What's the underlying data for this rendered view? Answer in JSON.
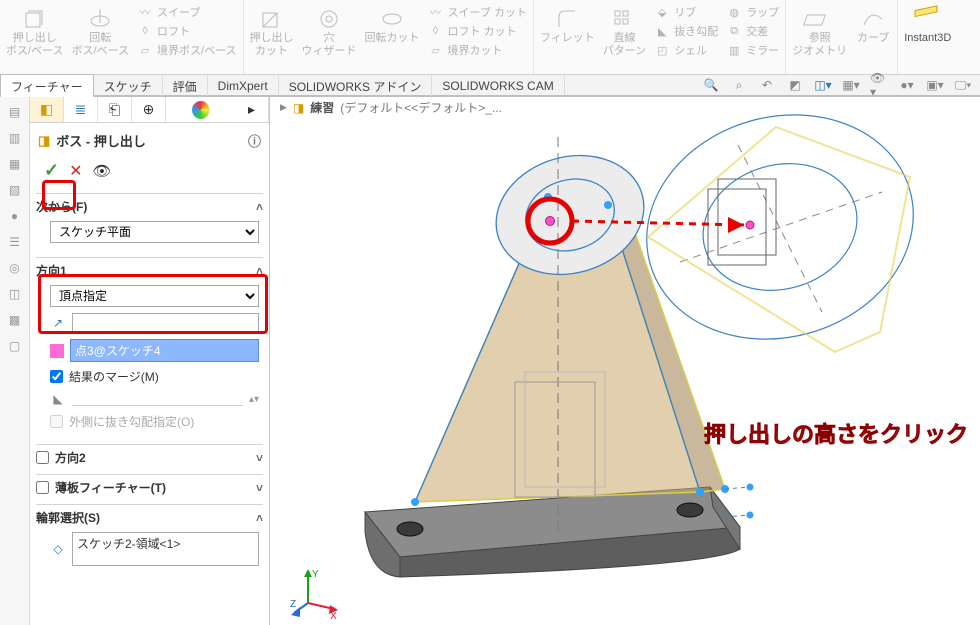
{
  "ribbon": {
    "g1": {
      "extrude": "押し出し\nボス/ベース",
      "revolve": "回転\nボス/ベース",
      "sweep": "スイープ",
      "loft": "ロフト",
      "boundary": "境界ボス/ベース"
    },
    "g2": {
      "cut": "押し出し\nカット",
      "wizard": "穴\nウィザード",
      "revcut": "回転カット",
      "sweepcut": "スイープ カット",
      "loftcut": "ロフト カット",
      "boundarycut": "境界カット"
    },
    "g3": {
      "fillet": "フィレット",
      "lpattern": "直線\nパターン",
      "rib": "リブ",
      "draft": "抜き勾配",
      "shell": "シェル",
      "wrap": "ラップ",
      "intersect": "交差",
      "mirror": "ミラー"
    },
    "g4": {
      "refgeom": "参照\nジオメトリ",
      "curves": "カーブ"
    },
    "g5": {
      "instant3d": "Instant3D"
    }
  },
  "tabs": {
    "t1": "フィーチャー",
    "t2": "スケッチ",
    "t3": "評価",
    "t4": "DimXpert",
    "t5": "SOLIDWORKS アドイン",
    "t6": "SOLIDWORKS CAM"
  },
  "breadcrumb": {
    "part": "練習",
    "config": "(デフォルト<<デフォルト>_..."
  },
  "pm": {
    "title": "ボス - 押し出し",
    "from_header": "次から(F)",
    "from_option": "スケッチ平面",
    "dir1_header": "方向1",
    "dir1_option": "頂点指定",
    "dir1_value": "",
    "dir1_selected": "点3@スケッチ4",
    "merge_label": "結果のマージ(M)",
    "draft_label": "外側に抜き勾配指定(O)",
    "dir2_label": "方向2",
    "thin_label": "薄板フィーチャー(T)",
    "contour_header": "輪郭選択(S)",
    "contour_item": "スケッチ2-領域<1>"
  },
  "annotation": "押し出しの高さをクリック",
  "triad": {
    "x": "X",
    "y": "Y",
    "z": "Z"
  }
}
